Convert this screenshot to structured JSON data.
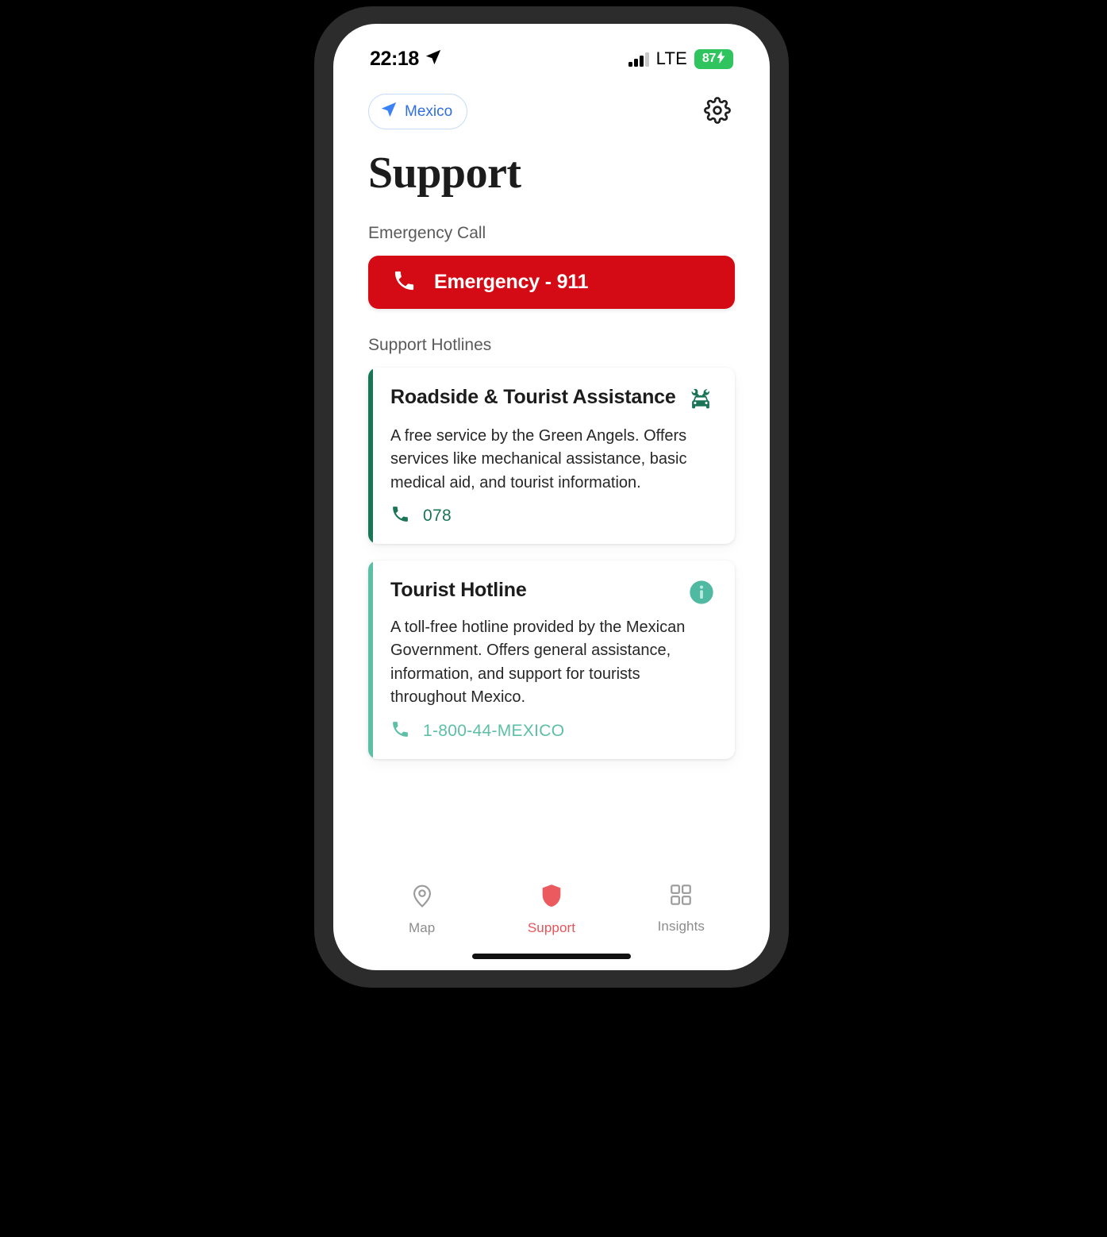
{
  "status_bar": {
    "time": "22:18",
    "location_icon": "location-arrow-icon",
    "signal_icon": "cellular-signal-icon",
    "network": "LTE",
    "battery_percent": "87",
    "battery_charging_icon": "lightning-bolt-icon"
  },
  "header": {
    "location_pill": {
      "icon": "navigation-arrow-icon",
      "label": "Mexico"
    },
    "settings_icon": "gear-icon"
  },
  "page_title": "Support",
  "sections": {
    "emergency_label": "Emergency Call",
    "hotlines_label": "Support Hotlines"
  },
  "emergency_button": {
    "icon": "phone-icon",
    "label": "Emergency - 911",
    "color": "#d40a14"
  },
  "hotlines": [
    {
      "title": "Roadside & Tourist Assistance",
      "description": "A free service by the Green Angels. Offers services like mechanical assistance, basic medical aid, and tourist information.",
      "phone": "078",
      "phone_icon": "phone-icon",
      "badge_icon": "car-repair-icon",
      "accent_color": "#1a7556",
      "text_color": "#1a7556"
    },
    {
      "title": "Tourist Hotline",
      "description": "A toll-free hotline provided by the Mexican Government. Offers general assistance, information, and support for tourists throughout Mexico.",
      "phone": "1-800-44-MEXICO",
      "phone_icon": "phone-icon",
      "badge_icon": "info-circle-icon",
      "accent_color": "#5cbfa6",
      "text_color": "#5cbfa6"
    }
  ],
  "tabs": [
    {
      "label": "Map",
      "icon": "map-pin-icon",
      "active": false
    },
    {
      "label": "Support",
      "icon": "shield-icon",
      "active": true
    },
    {
      "label": "Insights",
      "icon": "grid-icon",
      "active": false
    }
  ],
  "colors": {
    "accent_red": "#e8545b",
    "emergency_red": "#d40a14",
    "link_blue": "#2f6fe4",
    "green_dark": "#1a7556",
    "green_light": "#5cbfa6"
  }
}
